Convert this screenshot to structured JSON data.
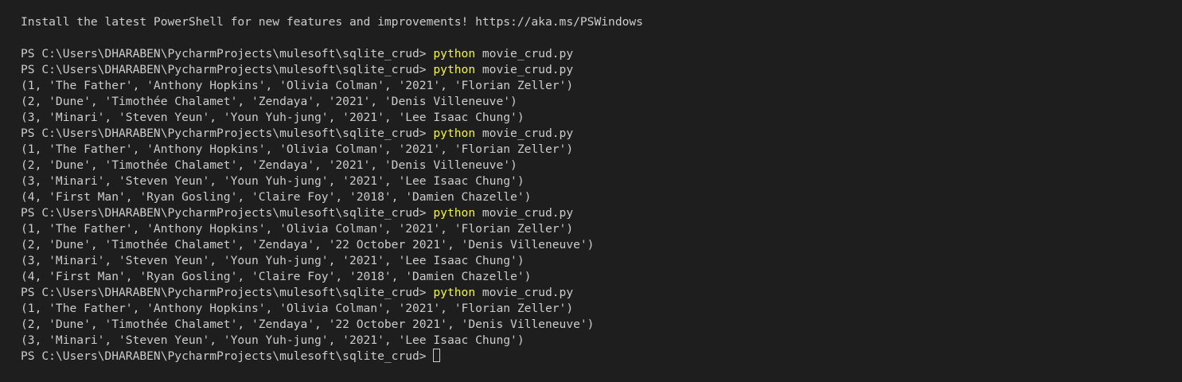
{
  "banner": "Install the latest PowerShell for new features and improvements! https://aka.ms/PSWindows",
  "prompt": "PS C:\\Users\\DHARABEN\\PycharmProjects\\mulesoft\\sqlite_crud> ",
  "cmd_word": "python",
  "cmd_args": " movie_crud.py",
  "colors": {
    "background": "#1e1e1e",
    "text": "#cccccc",
    "command": "#f5f543"
  },
  "runs": [
    {
      "rows": []
    },
    {
      "rows": [
        "(1, 'The Father', 'Anthony Hopkins', 'Olivia Colman', '2021', 'Florian Zeller')",
        "(2, 'Dune', 'Timothée Chalamet', 'Zendaya', '2021', 'Denis Villeneuve')",
        "(3, 'Minari', 'Steven Yeun', 'Youn Yuh-jung', '2021', 'Lee Isaac Chung')"
      ]
    },
    {
      "rows": [
        "(1, 'The Father', 'Anthony Hopkins', 'Olivia Colman', '2021', 'Florian Zeller')",
        "(2, 'Dune', 'Timothée Chalamet', 'Zendaya', '2021', 'Denis Villeneuve')",
        "(3, 'Minari', 'Steven Yeun', 'Youn Yuh-jung', '2021', 'Lee Isaac Chung')",
        "(4, 'First Man', 'Ryan Gosling', 'Claire Foy', '2018', 'Damien Chazelle')"
      ]
    },
    {
      "rows": [
        "(1, 'The Father', 'Anthony Hopkins', 'Olivia Colman', '2021', 'Florian Zeller')",
        "(2, 'Dune', 'Timothée Chalamet', 'Zendaya', '22 October 2021', 'Denis Villeneuve')",
        "(3, 'Minari', 'Steven Yeun', 'Youn Yuh-jung', '2021', 'Lee Isaac Chung')",
        "(4, 'First Man', 'Ryan Gosling', 'Claire Foy', '2018', 'Damien Chazelle')"
      ]
    },
    {
      "rows": [
        "(1, 'The Father', 'Anthony Hopkins', 'Olivia Colman', '2021', 'Florian Zeller')",
        "(2, 'Dune', 'Timothée Chalamet', 'Zendaya', '22 October 2021', 'Denis Villeneuve')",
        "(3, 'Minari', 'Steven Yeun', 'Youn Yuh-jung', '2021', 'Lee Isaac Chung')"
      ]
    }
  ]
}
